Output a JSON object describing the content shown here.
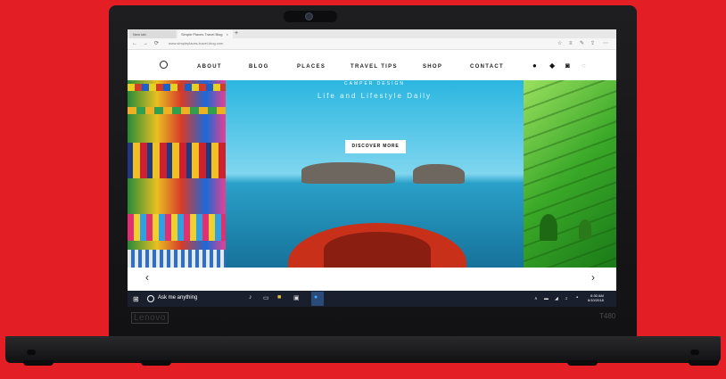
{
  "laptop": {
    "brand": "Lenovo",
    "model": "T480"
  },
  "browser": {
    "tabs": [
      {
        "label": "New tab"
      },
      {
        "label": "Simple Places Travel Blog"
      }
    ],
    "new_tab_symbol": "+",
    "close_symbol": "×",
    "back_icon": "←",
    "forward_icon": "→",
    "refresh_icon": "⟳",
    "url": "www.simpleplaces-travel-blog.com",
    "toolbar_icons": [
      "☆",
      "≡",
      "✎",
      "⇪",
      "⋯"
    ]
  },
  "site": {
    "menu": [
      "ABOUT",
      "BLOG",
      "PLACES",
      "TRAVEL TIPS",
      "SHOP",
      "CONTACT"
    ],
    "social_icons": [
      "facebook-icon",
      "twitter-icon",
      "instagram-icon",
      "search-icon"
    ],
    "hero": {
      "kicker": "CAMPER DESIGN",
      "title": "Life and Lifestyle Daily",
      "button": "DISCOVER MORE"
    },
    "prev_arrow": "‹",
    "next_arrow": "›"
  },
  "taskbar": {
    "search_text": "Ask me anything",
    "time": "6:30 AM",
    "date": "6/10/2018"
  },
  "colors": {
    "background": "#e31e24",
    "taskbar": "#1a1f2e"
  }
}
